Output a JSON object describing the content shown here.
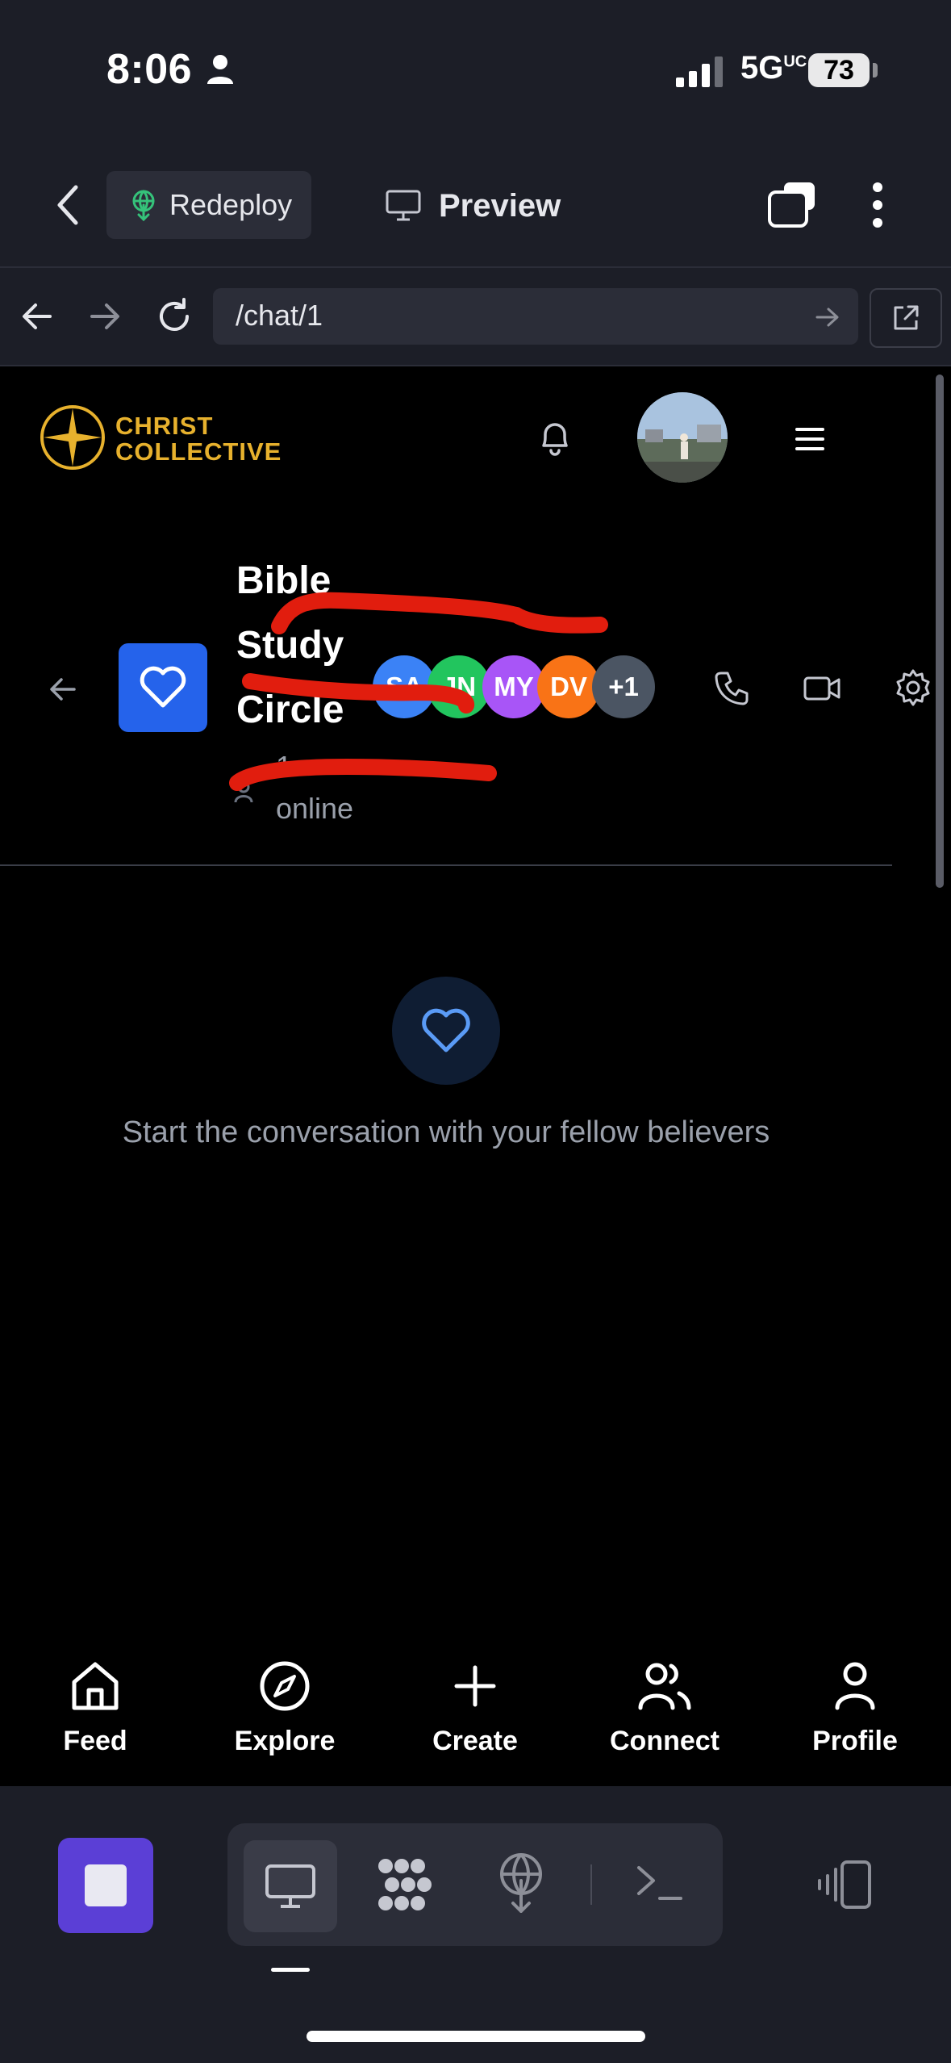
{
  "status_bar": {
    "time": "8:06",
    "network": "5G",
    "network_sub": "UC",
    "battery": "73"
  },
  "replit_header": {
    "redeploy_label": "Redeploy",
    "preview_label": "Preview"
  },
  "browser": {
    "url": "/chat/1"
  },
  "app_header": {
    "logo_line1": "CHRIST",
    "logo_line2": "COLLECTIVE",
    "brand_color": "#e7b12d"
  },
  "chat": {
    "group_name_lines": [
      "Bible",
      "Study",
      "Circle"
    ],
    "online_count": "1",
    "online_label": "online",
    "members": [
      "SA",
      "JN",
      "MY",
      "DV"
    ],
    "more_members": "+1",
    "member_colors": [
      "#3b82f6",
      "#22c55e",
      "#a855f7",
      "#f97316",
      "#4b5563"
    ],
    "group_icon_color": "#2563eb"
  },
  "empty_state": {
    "message": "Start the conversation with your fellow believers"
  },
  "bottom_nav": {
    "items": [
      {
        "label": "Feed",
        "icon": "home-icon"
      },
      {
        "label": "Explore",
        "icon": "compass-icon"
      },
      {
        "label": "Create",
        "icon": "plus-icon"
      },
      {
        "label": "Connect",
        "icon": "users-icon"
      },
      {
        "label": "Profile",
        "icon": "user-icon"
      }
    ]
  },
  "dock": {
    "stop_color": "#5b3fd6"
  }
}
